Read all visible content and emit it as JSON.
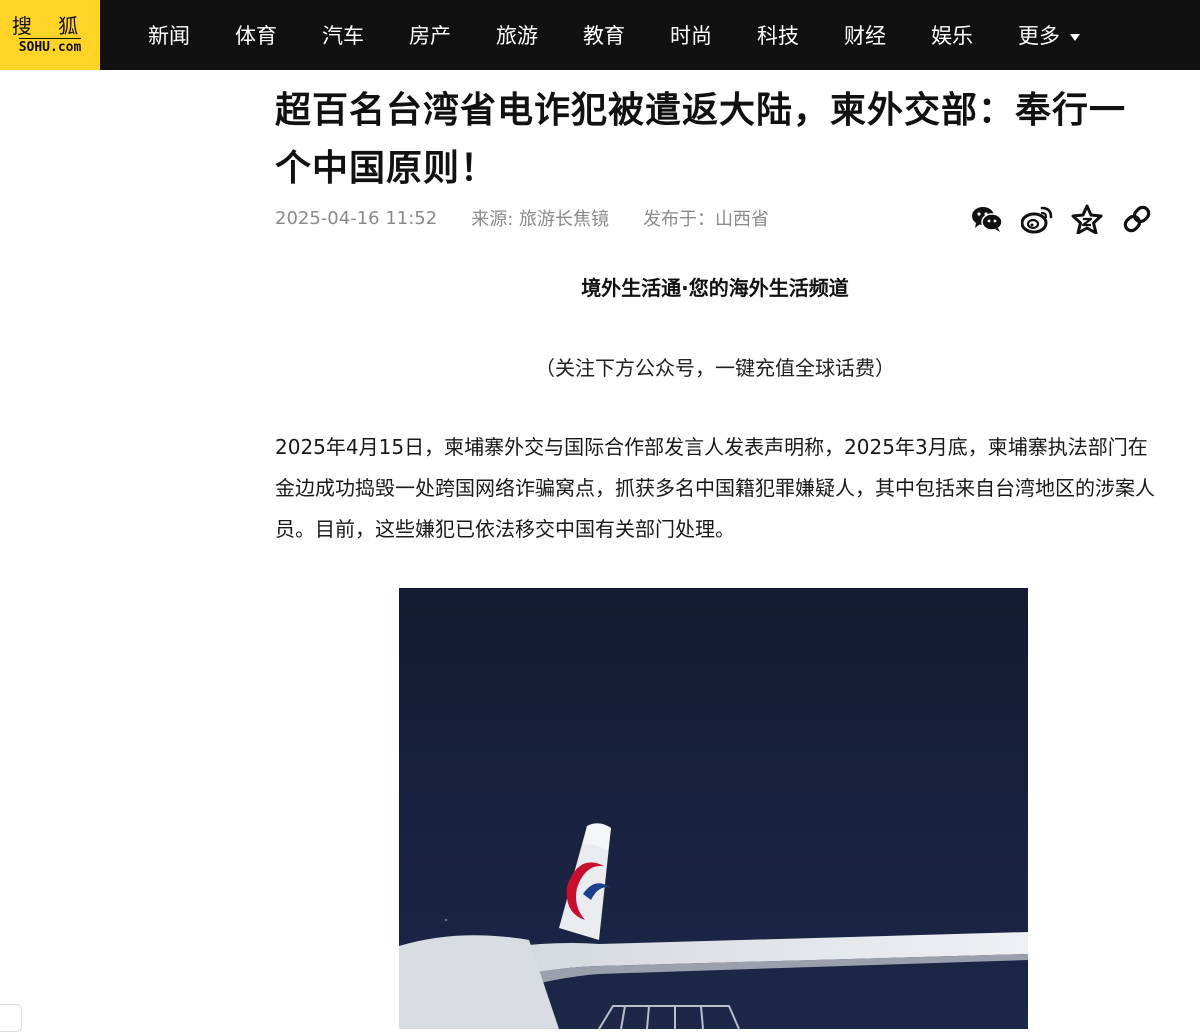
{
  "header": {
    "logo_cn": "搜 狐",
    "logo_en": "SOHU.com",
    "nav": [
      "新闻",
      "体育",
      "汽车",
      "房产",
      "旅游",
      "教育",
      "时尚",
      "科技",
      "财经",
      "娱乐",
      "更多"
    ]
  },
  "article": {
    "title": "超百名台湾省电诈犯被遣返大陆，柬外交部：奉行一个中国原则！",
    "datetime": "2025-04-16 11:52",
    "source": "来源: 旅游长焦镜",
    "published_in": "发布于：山西省",
    "share_icons": [
      "wechat-icon",
      "weibo-icon",
      "favorite-star-icon",
      "copy-link-icon"
    ],
    "subheading": "境外生活通·您的海外生活频道",
    "note": "（关注下方公众号，一键充值全球话费）",
    "paragraph": "2025年4月15日，柬埔寨外交与国际合作部发言人发表声明称，2025年3月底，柬埔寨执法部门在金边成功捣毁一处跨国网络诈骗窝点，抓获多名中国籍犯罪嫌疑人，其中包括来自台湾地区的涉案人员。目前，这些嫌犯已依法移交中国有关部门处理。",
    "image": "night photo of airliner tail with eastern swallow logo"
  },
  "colors": {
    "topbar": "#111111",
    "logo_bg": "#ffd426",
    "meta_text": "#8a8a8a",
    "logo_red": "#c8102e",
    "logo_blue": "#1a3f8c"
  }
}
